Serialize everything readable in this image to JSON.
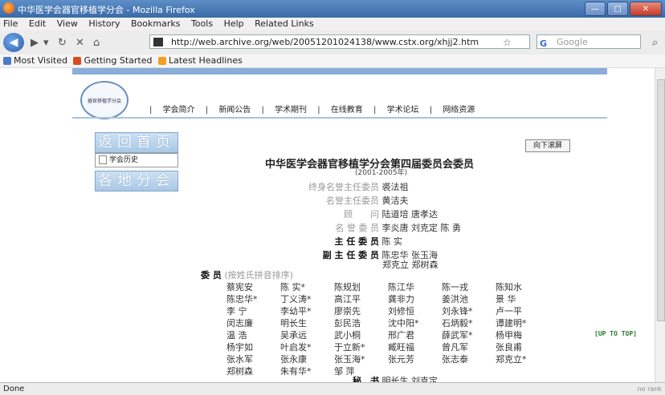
{
  "window": {
    "title": "中华医学会器官移植学分会 - Mozilla Firefox",
    "controls": [
      "—",
      "□",
      "✕"
    ]
  },
  "menu": {
    "items": [
      "File",
      "Edit",
      "View",
      "History",
      "Bookmarks",
      "Tools",
      "Help",
      "Related Links"
    ]
  },
  "nav": {
    "url": "http://web.archive.org/web/20051201024138/www.cstx.org/xhjj2.htm",
    "search_placeholder": "Google"
  },
  "bookmarks": {
    "items": [
      "Most Visited",
      "Getting Started",
      "Latest Headlines"
    ]
  },
  "page": {
    "logo_text": "器官移植学分会",
    "topnav": [
      "学会简介",
      "新闻公告",
      "学术期刊",
      "在线教育",
      "学术论坛",
      "网络资源"
    ],
    "side_buttons": [
      "返回首页",
      "各地分会"
    ],
    "history_link": "学会历史",
    "scroll_down": "向下滚屏",
    "title": "中华医学会器官移植学分会第四届委员会委员",
    "years": "(2001-2005年)",
    "roles": [
      {
        "label": "终身名誉主任委员",
        "names": "裘法祖"
      },
      {
        "label": "名誉主任委员",
        "names": "黄洁夫"
      },
      {
        "label": "顾　　问",
        "names": "陆道培 唐孝达"
      },
      {
        "label": "名 誉 委 员",
        "names": "李炎唐 刘克定 陈 勇"
      },
      {
        "label": "主 任 委 员",
        "names": "陈 实"
      },
      {
        "label": "副 主 任 委 员",
        "names": "陈忠华 张玉海",
        "names2": "郑克立 郑树森"
      }
    ],
    "members_label": "委 员",
    "members_note": "(按姓氏拼音排序)",
    "members": [
      [
        "蔡宪安",
        "陈 实*",
        "陈规划",
        "陈江华",
        "陈一戎",
        "陈知水"
      ],
      [
        "陈忠华*",
        "丁义涛*",
        "高江平",
        "龚非力",
        "姜洪池",
        "景 华"
      ],
      [
        "李 宁",
        "李幼平*",
        "廖崇先",
        "刘修恒",
        "刘永锋*",
        "卢一平"
      ],
      [
        "闵志廉",
        "明长生",
        "彭民浩",
        "沈中阳*",
        "石炳毅*",
        "谭建明*"
      ],
      [
        "温 浩",
        "吴承远",
        "武小桐",
        "邢广君",
        "薛武军*",
        "杨甲梅"
      ],
      [
        "杨宇如",
        "叶启发*",
        "于立新*",
        "臧旺福",
        "曾凡军",
        "张良甫"
      ],
      [
        "张水军",
        "张永康",
        "张玉海*",
        "张元芳",
        "张志泰",
        "郑克立*"
      ],
      [
        "郑树森",
        "朱有华*",
        "邹 萍"
      ]
    ],
    "secretary_label": "秘　书",
    "secretary_names": "明长生 刘克定",
    "up_to_top": "[UP TO TOP]"
  },
  "status": {
    "text": "Done",
    "tray": "no rank"
  }
}
